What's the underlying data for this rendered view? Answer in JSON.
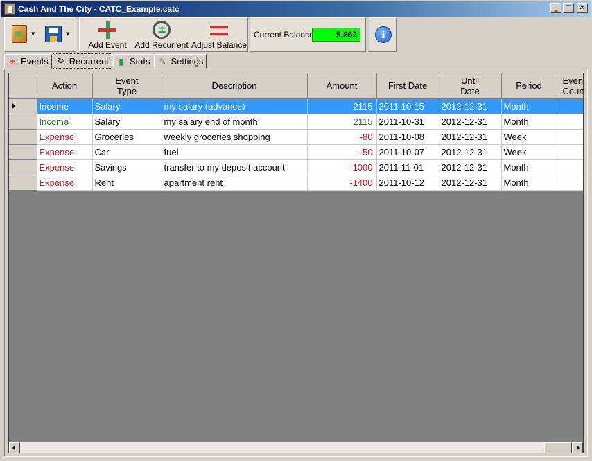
{
  "window": {
    "title": "Cash And The City - CATC_Example.catc",
    "minimize": "_",
    "maximize": "□",
    "close": "✕"
  },
  "toolbar": {
    "add_event": "Add Event",
    "add_recurrent": "Add Recurrent",
    "adjust_balance": "Adjust Balance",
    "balance_label": "Current Balance:",
    "balance_value": "5 862",
    "balance_color": "#00ff00",
    "dropdown_arrow": "▼",
    "info_glyph": "i"
  },
  "tabs": [
    {
      "label": "Events",
      "icon": "plus-minus-icon"
    },
    {
      "label": "Recurrent",
      "icon": "recurrent-icon"
    },
    {
      "label": "Stats",
      "icon": "bar-chart-icon"
    },
    {
      "label": "Settings",
      "icon": "wrench-icon"
    }
  ],
  "grid": {
    "columns": [
      "Action",
      "Event\nType",
      "Description",
      "Amount",
      "First Date",
      "Until\nDate",
      "Period",
      "Event\nCount"
    ],
    "rows": [
      {
        "action": "Income",
        "type": "Salary",
        "description": "my salary (advance)",
        "amount": "2115",
        "first_date": "2011-10-15",
        "until_date": "2012-12-31",
        "period": "Month",
        "count": ""
      },
      {
        "action": "Income",
        "type": "Salary",
        "description": "my salary end of month",
        "amount": "2115",
        "first_date": "2011-10-31",
        "until_date": "2012-12-31",
        "period": "Month",
        "count": ""
      },
      {
        "action": "Expense",
        "type": "Groceries",
        "description": "weekly groceries shopping",
        "amount": "-80",
        "first_date": "2011-10-08",
        "until_date": "2012-12-31",
        "period": "Week",
        "count": ""
      },
      {
        "action": "Expense",
        "type": "Car",
        "description": "fuel",
        "amount": "-50",
        "first_date": "2011-10-07",
        "until_date": "2012-12-31",
        "period": "Week",
        "count": ""
      },
      {
        "action": "Expense",
        "type": "Savings",
        "description": "transfer to my deposit account",
        "amount": "-1000",
        "first_date": "2011-11-01",
        "until_date": "2012-12-31",
        "period": "Month",
        "count": ""
      },
      {
        "action": "Expense",
        "type": "Rent",
        "description": "apartment rent",
        "amount": "-1400",
        "first_date": "2011-10-12",
        "until_date": "2012-12-31",
        "period": "Month",
        "count": ""
      }
    ],
    "selected_row": 0
  },
  "colors": {
    "income": "#2a7a2a",
    "expense": "#e01010",
    "selection": "#3399ff"
  }
}
